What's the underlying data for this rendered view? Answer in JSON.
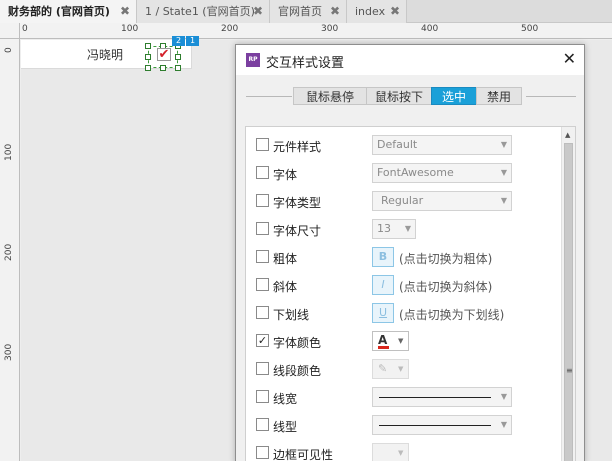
{
  "tabs": [
    {
      "label": "财务部的 (官网首页)",
      "close": "✖",
      "active": true
    },
    {
      "label": "1 / State1 (官网首页)",
      "close": "✖",
      "active": false
    },
    {
      "label": "官网首页",
      "close": "✖",
      "active": false
    },
    {
      "label": "index",
      "close": "✖",
      "active": false
    }
  ],
  "ruler": {
    "h_labels": [
      "0",
      "100",
      "200",
      "300",
      "400",
      "500"
    ],
    "v_labels": [
      "0",
      "100",
      "200",
      "300"
    ]
  },
  "canvas": {
    "widget_label": "冯晓明",
    "checkbox_mark": "✔",
    "badge_left": "2",
    "badge_right": "1"
  },
  "dialog": {
    "logo": "RP",
    "title": "交互样式设置",
    "close": "✕",
    "segments": [
      "鼠标悬停",
      "鼠标按下",
      "选中",
      "禁用"
    ],
    "active_segment": "选中",
    "scroll_up": "▲",
    "scroll_grip": "≡",
    "rows": [
      {
        "label": "元件样式",
        "checked": false,
        "value": "Default"
      },
      {
        "label": "字体",
        "checked": false,
        "value": "FontAwesome"
      },
      {
        "label": "字体类型",
        "checked": false,
        "value": "Regular"
      },
      {
        "label": "字体尺寸",
        "checked": false,
        "value": "13"
      },
      {
        "label": "粗体",
        "checked": false,
        "button": "B",
        "hint": "(点击切换为粗体)"
      },
      {
        "label": "斜体",
        "checked": false,
        "button": "I",
        "hint": "(点击切换为斜体)"
      },
      {
        "label": "下划线",
        "checked": false,
        "button": "U",
        "hint": "(点击切换为下划线)"
      },
      {
        "label": "字体颜色",
        "checked": true,
        "color_letter": "A",
        "color": "#d9261c"
      },
      {
        "label": "线段颜色",
        "checked": false,
        "icon": "✎"
      },
      {
        "label": "线宽",
        "checked": false
      },
      {
        "label": "线型",
        "checked": false
      },
      {
        "label": "边框可见性",
        "checked": false
      }
    ],
    "check_mark": "✓",
    "dropdown_arrow": "▼"
  },
  "colors": {
    "accent": "#1aa0d8",
    "font_color": "#d9261c",
    "selection": "#3c9a3c",
    "logo_bg": "#7b3fa0"
  }
}
